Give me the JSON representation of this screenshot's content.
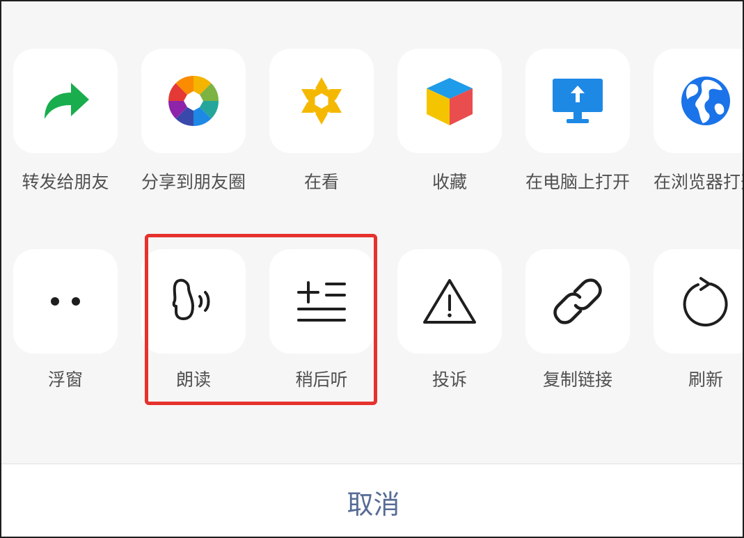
{
  "row1": [
    {
      "label": "转发给朋友",
      "icon": "forward-arrow-icon"
    },
    {
      "label": "分享到朋友圈",
      "icon": "moments-aperture-icon"
    },
    {
      "label": "在看",
      "icon": "top-stories-star-icon"
    },
    {
      "label": "收藏",
      "icon": "favorites-cube-icon"
    },
    {
      "label": "在电脑上打开",
      "icon": "monitor-upload-icon"
    },
    {
      "label": "在浏览器打开",
      "icon": "globe-icon"
    }
  ],
  "row2": [
    {
      "label": "浮窗",
      "icon": "float-window-dots-icon"
    },
    {
      "label": "朗读",
      "icon": "read-aloud-icon"
    },
    {
      "label": "稍后听",
      "icon": "listen-later-icon"
    },
    {
      "label": "投诉",
      "icon": "warning-triangle-icon"
    },
    {
      "label": "复制链接",
      "icon": "link-icon"
    },
    {
      "label": "刷新",
      "icon": "refresh-icon"
    }
  ],
  "cancel": {
    "label": "取消"
  },
  "colors": {
    "highlight": "#e5322d",
    "cancel_text": "#576b95",
    "forward_green": "#1aad4e",
    "monitor_blue": "#1e88e5",
    "globe_blue": "#1a73e8"
  }
}
